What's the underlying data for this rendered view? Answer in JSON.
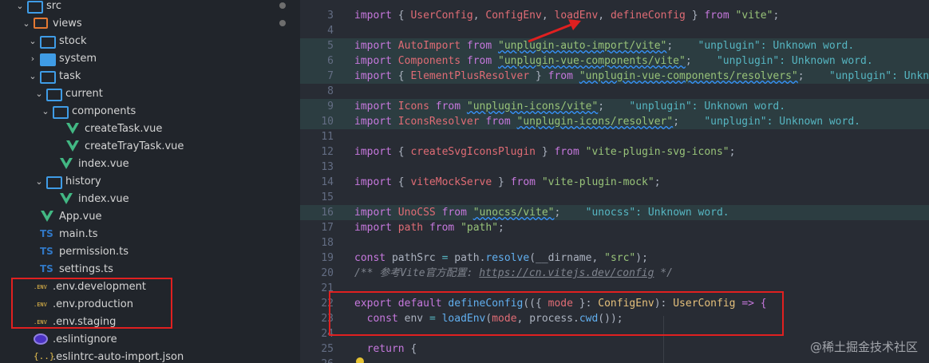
{
  "explorer": {
    "items": [
      {
        "label": "src",
        "type": "src-folder",
        "chevron": "⌄",
        "badge": true
      },
      {
        "label": "views",
        "type": "views-folder",
        "chevron": "⌄",
        "badge": true
      },
      {
        "label": "stock",
        "type": "folder",
        "chevron": "⌄"
      },
      {
        "label": "system",
        "type": "folder-filled",
        "chevron": "›"
      },
      {
        "label": "task",
        "type": "folder",
        "chevron": "⌄"
      },
      {
        "label": "current",
        "type": "folder",
        "chevron": "⌄"
      },
      {
        "label": "components",
        "type": "folder",
        "chevron": "⌄"
      },
      {
        "label": "createTask.vue",
        "type": "vue"
      },
      {
        "label": "createTrayTask.vue",
        "type": "vue"
      },
      {
        "label": "index.vue",
        "type": "vue"
      },
      {
        "label": "history",
        "type": "folder",
        "chevron": "⌄"
      },
      {
        "label": "index.vue",
        "type": "vue"
      },
      {
        "label": "App.vue",
        "type": "vue"
      },
      {
        "label": "main.ts",
        "type": "ts"
      },
      {
        "label": "permission.ts",
        "type": "ts"
      },
      {
        "label": "settings.ts",
        "type": "ts"
      },
      {
        "label": ".env.development",
        "type": "env"
      },
      {
        "label": ".env.production",
        "type": "env"
      },
      {
        "label": ".env.staging",
        "type": "env"
      },
      {
        "label": ".eslintignore",
        "type": "eslint"
      },
      {
        "label": ".eslintrc-auto-import.json",
        "type": "json"
      }
    ],
    "icon_text": {
      "ts": "TS",
      "env": ".ENV",
      "json": "{..}"
    }
  },
  "editor": {
    "line_numbers": [
      "3",
      "4",
      "5",
      "6",
      "7",
      "8",
      "9",
      "10",
      "11",
      "12",
      "13",
      "14",
      "15",
      "16",
      "17",
      "18",
      "19",
      "20",
      "21",
      "22",
      "23",
      "24",
      "25",
      "26"
    ],
    "lines": {
      "l3": {
        "a": "import",
        "b": " { ",
        "c": "UserConfig",
        "d": ", ",
        "e": "ConfigEnv",
        "f": ", ",
        "g": "loadEnv",
        "h": ", ",
        "i": "defineConfig",
        "j": " } ",
        "k": "from",
        "l": " ",
        "m": "\"vite\"",
        "n": ";"
      },
      "l5": {
        "a": "import",
        "b": " AutoImport ",
        "c": "from",
        "d": " ",
        "e": "\"unplugin-auto-import/vite\"",
        "f": ";",
        "w": "    \"unplugin\": Unknown word."
      },
      "l6": {
        "a": "import",
        "b": " Components ",
        "c": "from",
        "d": " ",
        "e": "\"unplugin-vue-components/vite\"",
        "f": ";",
        "w": "    \"unplugin\": Unknown word."
      },
      "l7": {
        "a": "import",
        "b": " { ",
        "c": "ElementPlusResolver",
        "d": " } ",
        "e": "from",
        "f": " ",
        "g": "\"unplugin-vue-components/resolvers\"",
        "h": ";",
        "w": "    \"unplugin\": Unknow"
      },
      "l9": {
        "a": "import",
        "b": " Icons ",
        "c": "from",
        "d": " ",
        "e": "\"unplugin-icons/vite\"",
        "f": ";",
        "w": "    \"unplugin\": Unknown word."
      },
      "l10": {
        "a": "import",
        "b": " IconsResolver ",
        "c": "from",
        "d": " ",
        "e": "\"unplugin-icons/resolver\"",
        "f": ";",
        "w": "    \"unplugin\": Unknown word."
      },
      "l12": {
        "a": "import",
        "b": " { ",
        "c": "createSvgIconsPlugin",
        "d": " } ",
        "e": "from",
        "f": " ",
        "g": "\"vite-plugin-svg-icons\"",
        "h": ";"
      },
      "l14": {
        "a": "import",
        "b": " { ",
        "c": "viteMockServe",
        "d": " } ",
        "e": "from",
        "f": " ",
        "g": "\"vite-plugin-mock\"",
        "h": ";"
      },
      "l16": {
        "a": "import",
        "b": " UnoCSS ",
        "c": "from",
        "d": " ",
        "e": "\"unocss/vite\"",
        "f": ";",
        "w": "    \"unocss\": Unknown word."
      },
      "l17": {
        "a": "import",
        "b": " path ",
        "c": "from",
        "d": " ",
        "e": "\"path\"",
        "f": ";"
      },
      "l19": {
        "a": "const",
        "b": " pathSrc ",
        "c": "= ",
        "d": "path",
        "e": ".",
        "f": "resolve",
        "g": "(",
        "h": "__dirname",
        "i": ", ",
        "j": "\"src\"",
        "k": ");"
      },
      "l20": {
        "a": "/** 参考Vite官方配置: ",
        "b": "https://cn.vitejs.dev/config",
        "c": " */"
      },
      "l22": {
        "a": "export",
        "b": " ",
        "c": "default",
        "d": " ",
        "e": "defineConfig",
        "f": "(({ ",
        "g": "mode",
        "h": " }: ",
        "i": "ConfigEnv",
        "j": "): ",
        "k": "UserConfig",
        "l": " => {"
      },
      "l23": {
        "a": "  const",
        "b": " env ",
        "c": "= ",
        "d": "loadEnv",
        "e": "(",
        "f": "mode",
        "g": ", ",
        "h": "process",
        "i": ".",
        "j": "cwd",
        "k": "());"
      },
      "l25": {
        "a": "  return",
        "b": " {"
      }
    }
  },
  "watermark": "@稀土掘金技术社区",
  "colors": {
    "sidebar_bg": "#21252b",
    "editor_bg": "#282c34",
    "annotation_red": "#e02020"
  }
}
